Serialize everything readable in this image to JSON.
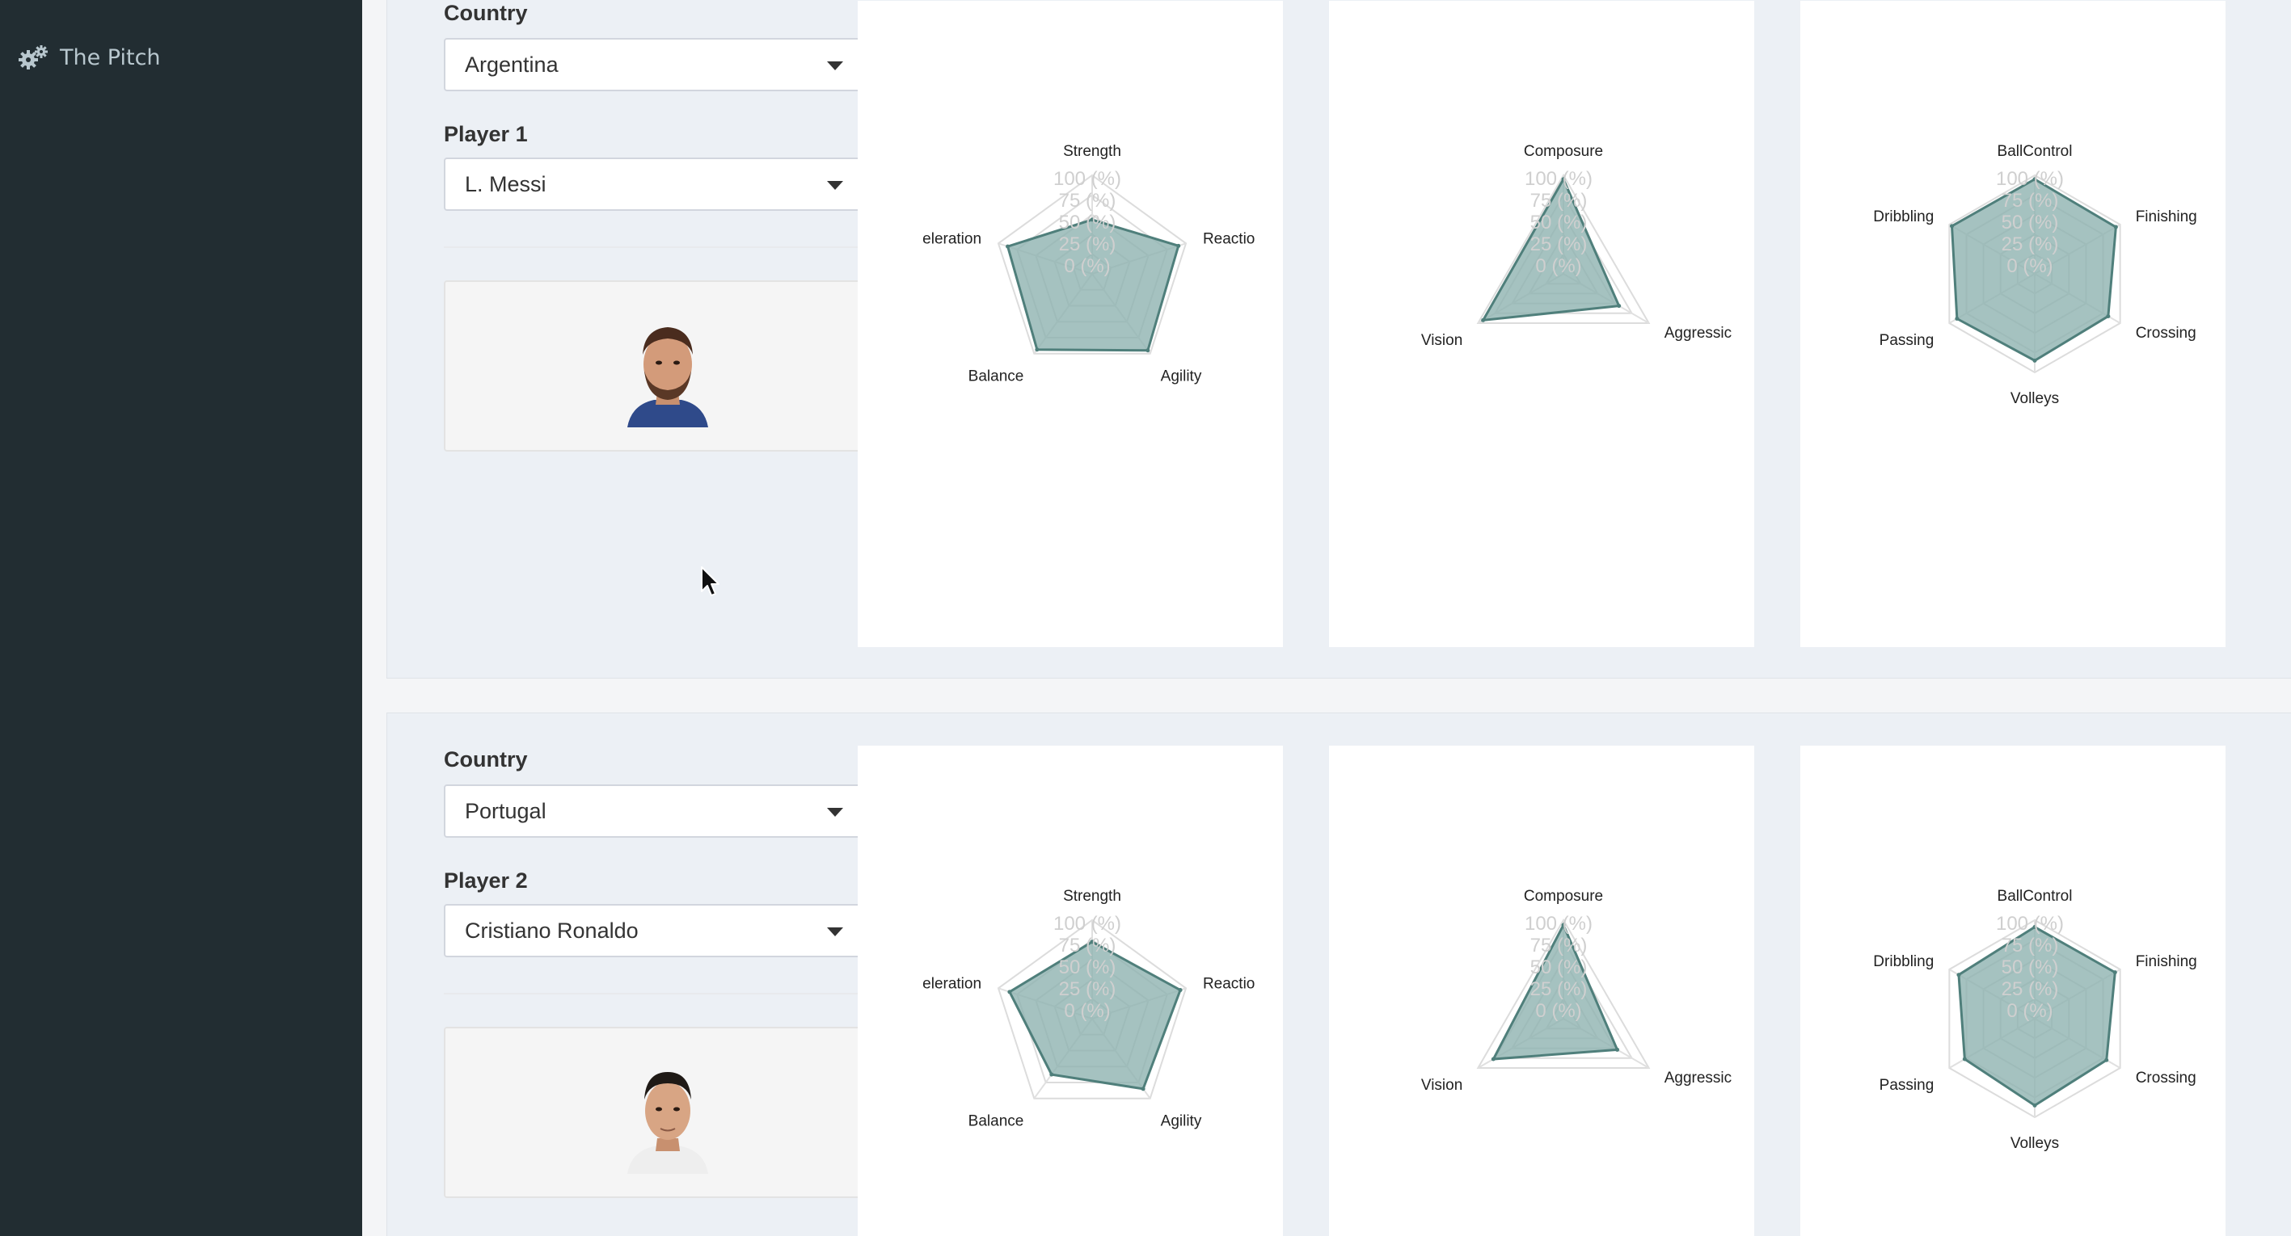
{
  "app": {
    "title": "The Pitch",
    "icon": "gears-icon"
  },
  "players": [
    {
      "country_label": "Country",
      "country_value": "Argentina",
      "player_label": "Player 1",
      "player_value": "L. Messi",
      "photo": "player-photo-messi"
    },
    {
      "country_label": "Country",
      "country_value": "Portugal",
      "player_label": "Player 2",
      "player_value": "Cristiano Ronaldo",
      "photo": "player-photo-ronaldo"
    }
  ],
  "chart_data": [
    {
      "type": "radar",
      "player": "L. Messi",
      "axes": [
        "Strength",
        "Reactio",
        "Agility",
        "Balance",
        "eleration"
      ],
      "ticks": [
        "100 (%)",
        "75 (%)",
        "50 (%)",
        "25 (%)",
        "0 (%)"
      ],
      "values": [
        55,
        92,
        96,
        95,
        90
      ],
      "fill": "#8fb3b0",
      "stroke": "#4f7f7b"
    },
    {
      "type": "radar",
      "player": "L. Messi",
      "axes": [
        "Composure",
        "Aggressic",
        "Vision"
      ],
      "ticks": [
        "100 (%)",
        "75 (%)",
        "50 (%)",
        "25 (%)",
        "0 (%)"
      ],
      "values": [
        96,
        65,
        94
      ],
      "fill": "#8fb3b0",
      "stroke": "#4f7f7b"
    },
    {
      "type": "radar",
      "player": "L. Messi",
      "axes": [
        "BallControl",
        "Finishing",
        "Crossing",
        "Volleys",
        "Passing",
        "Dribbling"
      ],
      "ticks": [
        "100 (%)",
        "75 (%)",
        "50 (%)",
        "25 (%)",
        "0 (%)"
      ],
      "values": [
        96,
        95,
        86,
        88,
        91,
        97
      ],
      "fill": "#8fb3b0",
      "stroke": "#4f7f7b"
    },
    {
      "type": "radar",
      "player": "Cristiano Ronaldo",
      "axes": [
        "Strength",
        "Reactio",
        "Agility",
        "Balance",
        "eleration"
      ],
      "ticks": [
        "100 (%)",
        "75 (%)",
        "50 (%)",
        "25 (%)",
        "0 (%)"
      ],
      "values": [
        78,
        94,
        88,
        70,
        88
      ],
      "fill": "#8fb3b0",
      "stroke": "#4f7f7b"
    },
    {
      "type": "radar",
      "player": "Cristiano Ronaldo",
      "axes": [
        "Composure",
        "Aggressic",
        "Vision"
      ],
      "ticks": [
        "100 (%)",
        "75 (%)",
        "50 (%)",
        "25 (%)",
        "0 (%)"
      ],
      "values": [
        95,
        63,
        82
      ],
      "fill": "#8fb3b0",
      "stroke": "#4f7f7b"
    },
    {
      "type": "radar",
      "player": "Cristiano Ronaldo",
      "axes": [
        "BallControl",
        "Finishing",
        "Crossing",
        "Volleys",
        "Passing",
        "Dribbling"
      ],
      "ticks": [
        "100 (%)",
        "75 (%)",
        "50 (%)",
        "25 (%)",
        "0 (%)"
      ],
      "values": [
        93,
        94,
        84,
        88,
        82,
        89
      ],
      "fill": "#8fb3b0",
      "stroke": "#4f7f7b"
    }
  ]
}
